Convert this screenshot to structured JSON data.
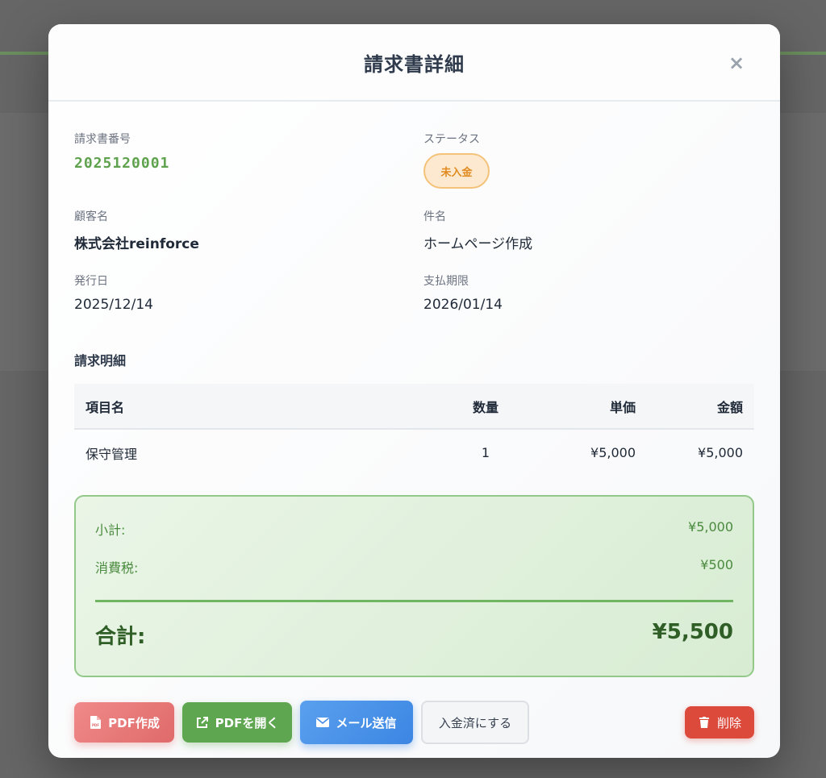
{
  "modal": {
    "title": "請求書詳細",
    "close_symbol": "×"
  },
  "invoice": {
    "number_label": "請求書番号",
    "number": "2025120001",
    "status_label": "ステータス",
    "status": "未入金",
    "customer_label": "顧客名",
    "customer": "株式会社reinforce",
    "subject_label": "件名",
    "subject": "ホームページ作成",
    "issue_date_label": "発行日",
    "issue_date": "2025/12/14",
    "due_date_label": "支払期限",
    "due_date": "2026/01/14"
  },
  "details": {
    "title": "請求明細",
    "columns": [
      "項目名",
      "数量",
      "単価",
      "金額"
    ],
    "rows": [
      {
        "name": "保守管理",
        "qty": "1",
        "price": "¥5,000",
        "amount": "¥5,000"
      }
    ]
  },
  "totals": {
    "subtotal_label": "小計:",
    "subtotal": "¥5,000",
    "tax_label": "消費税:",
    "tax": "¥500",
    "total_label": "合計:",
    "total": "¥5,500"
  },
  "actions": {
    "pdf_create": "PDF作成",
    "pdf_open": "PDFを開く",
    "send_mail": "メール送信",
    "mark_paid": "入金済にする",
    "delete": "削除"
  },
  "colors": {
    "accent_green": "#5ea650",
    "status_orange": "#e08a1e",
    "danger": "#dc4a3c",
    "mail_blue": "#3c86e3"
  }
}
